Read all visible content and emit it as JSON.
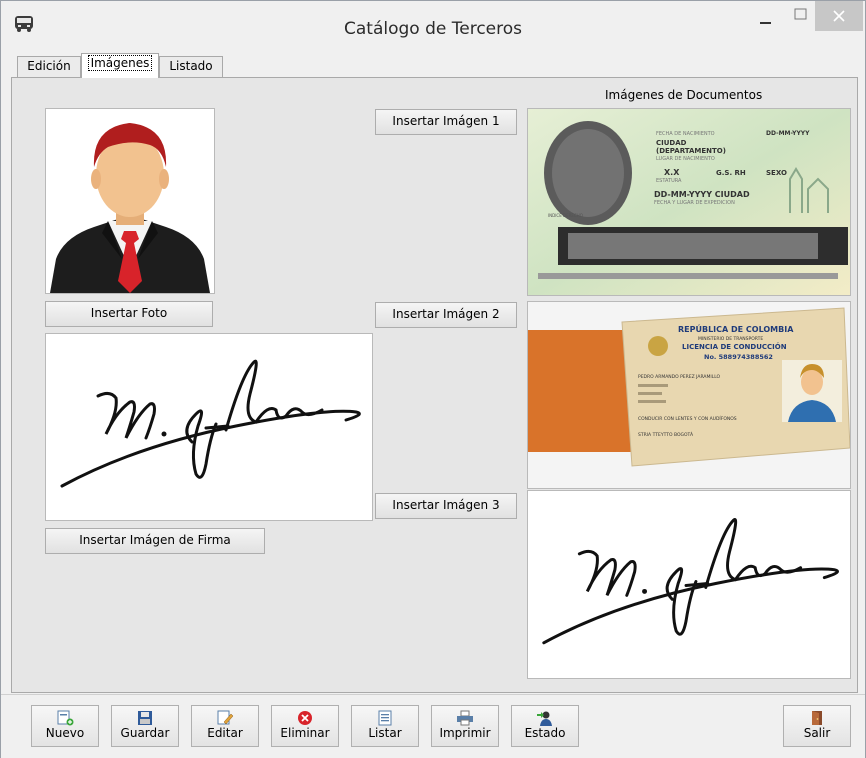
{
  "window": {
    "title": "Catálogo de Terceros"
  },
  "tabs": [
    {
      "label": "Edición"
    },
    {
      "label": "Imágenes"
    },
    {
      "label": "Listado"
    }
  ],
  "images_panel": {
    "documents_label": "Imágenes de Documentos",
    "insert_photo": "Insertar Foto",
    "insert_signature": "Insertar Imágen de Firma",
    "insert_image_1": "Insertar Imágen 1",
    "insert_image_2": "Insertar Imágen 2",
    "insert_image_3": "Insertar Imágen 3"
  },
  "id_card": {
    "birth_date_label": "FECHA DE NACIMIENTO",
    "birth_date": "DD-MM-YYYY",
    "city": "CIUDAD",
    "department": "(DEPARTAMENTO)",
    "birth_place_label": "LUGAR DE NACIMIENTO",
    "height": "X.X",
    "height_label": "ESTATURA",
    "blood": "G.S. RH",
    "sex_label": "SEXO",
    "issue": "DD-MM-YYYY CIUDAD",
    "issue_label": "FECHA Y LUGAR DE EXPEDICION",
    "index_label": "INDICE DERECHO"
  },
  "license": {
    "country": "REPÚBLICA DE COLOMBIA",
    "ministry": "MINISTERIO DE TRANSPORTE",
    "type": "LICENCIA DE CONDUCCIÓN",
    "number": "No. 588974388562",
    "name": "PEDRO ARMANDO PEREZ JARAMILLO",
    "conditions": "CONDUCIR CON LENTES Y CON AUDÍFONOS",
    "office": "STRIA TTEYTTO BOGOTÁ"
  },
  "toolbar": {
    "new": "Nuevo",
    "save": "Guardar",
    "edit": "Editar",
    "delete": "Eliminar",
    "list": "Listar",
    "print": "Imprimir",
    "status": "Estado",
    "exit": "Salir"
  },
  "colors": {
    "accent_orange": "#d9732a",
    "id_card_green": "#cfe3c2",
    "license_beige": "#e8d7b0",
    "avatar_hair": "#b01e1e",
    "avatar_skin": "#f2c28f",
    "avatar_tie": "#d8232a",
    "close_button": "#c7c7c7"
  }
}
